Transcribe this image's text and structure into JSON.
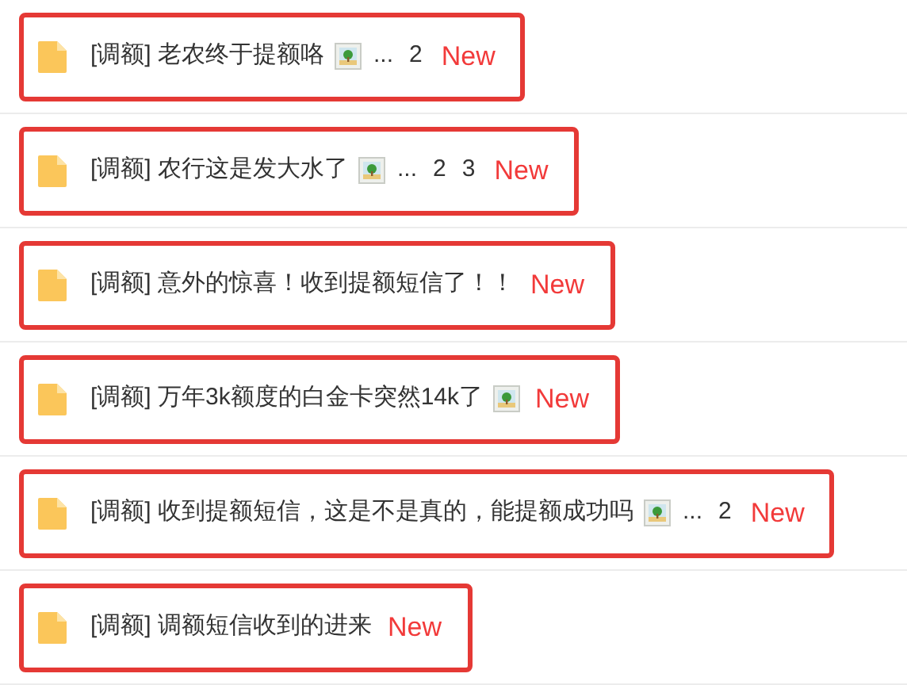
{
  "threads": [
    {
      "tag": "[调额]",
      "title": "老农终于提额咯",
      "has_image": true,
      "pages": [
        "...",
        "2"
      ],
      "badge": "New",
      "highlighted": true
    },
    {
      "tag": "[调额]",
      "title": "农行这是发大水了",
      "has_image": true,
      "pages": [
        "...",
        "2",
        "3"
      ],
      "badge": "New",
      "highlighted": true
    },
    {
      "tag": "[调额]",
      "title": "意外的惊喜！收到提额短信了！！",
      "has_image": false,
      "badge": "New",
      "highlighted": true
    },
    {
      "tag": "[调额]",
      "title": "万年3k额度的白金卡突然14k了",
      "has_image": true,
      "badge": "New",
      "highlighted": true
    },
    {
      "tag": "[调额]",
      "title": "收到提额短信，这是不是真的，能提额成功吗",
      "has_image": true,
      "pages": [
        "...",
        "2"
      ],
      "badge": "New",
      "highlighted": true
    },
    {
      "tag": "[调额]",
      "title": "调额短信收到的进来",
      "has_image": false,
      "badge": "New",
      "highlighted": true
    }
  ]
}
